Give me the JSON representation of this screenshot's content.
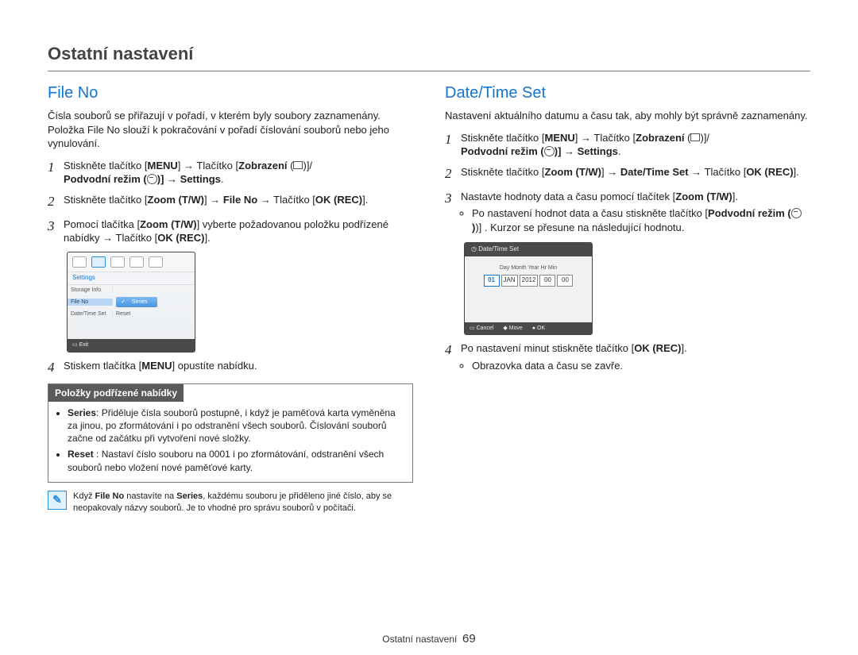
{
  "chapter": "Ostatní nastavení",
  "left": {
    "heading": "File No",
    "intro": "Čísla souborů se přiřazují v pořadí, v kterém byly soubory zaznamenány. Položka File No slouží k pokračování v pořadí číslování souborů nebo jeho vynulování.",
    "steps": {
      "s1a": "Stiskněte tlačítko [",
      "s1b": "] → Tlačítko [",
      "s1c": " (",
      "s1d": ")]/",
      "s1e": "Podvodní režim (",
      "s1f": ")] → ",
      "s1g": ".",
      "menu": "MENU",
      "display": "Zobrazení",
      "settings": "Settings",
      "s2a": "Stiskněte tlačítko [",
      "s2b": "] → ",
      "s2c": " → Tlačítko [",
      "s2d": "].",
      "zoom": "Zoom (T/W)",
      "fileno": "File No",
      "okrec": "OK (REC)",
      "s3a": "Pomocí tlačítka [",
      "s3b": "] vyberte požadovanou položku podřízené nabídky → Tlačítko [",
      "s3c": "].",
      "s4a": "Stiskem tlačítka [",
      "s4b": "] opustíte nabídku."
    },
    "shot": {
      "settings": "Settings",
      "storage": "Storage Info",
      "fileno": "File No",
      "datetime": "Date/Time Set",
      "series": "Series",
      "reset": "Reset",
      "exit": "Exit"
    },
    "subbox": {
      "title": "Položky podřízené nabídky",
      "series_label": "Series",
      "series_text": ": Přiděluje čísla souborů postupně, i když je paměťová karta vyměněna za jinou, po zformátování i po odstranění všech souborů. Číslování souborů začne od začátku při vytvoření nové složky.",
      "reset_label": "Reset",
      "reset_text": " : Nastaví číslo souboru na 0001 i po zformátování, odstranění všech souborů nebo vložení nové paměťové karty."
    },
    "tip_a": "Když ",
    "tip_bold1": "File No",
    "tip_b": " nastavíte na ",
    "tip_bold2": "Series",
    "tip_c": ", každému souboru je přiděleno jiné číslo, aby se neopakovaly názvy souborů. Je to vhodné pro správu souborů v počítači."
  },
  "right": {
    "heading": "Date/Time Set",
    "intro": "Nastavení aktuálního datumu a času tak, aby mohly být správně zaznamenány.",
    "steps": {
      "s1a": "Stiskněte tlačítko [",
      "s1b": "] → Tlačítko [",
      "s1c": " (",
      "s1d": ")]/",
      "s1e": "Podvodní režim (",
      "s1f": ")] → ",
      "s1g": ".",
      "menu": "MENU",
      "display": "Zobrazení",
      "settings": "Settings",
      "s2a": "Stiskněte tlačítko [",
      "s2b": "] → ",
      "s2c": " → Tlačítko [",
      "s2d": "].",
      "zoom": "Zoom (T/W)",
      "dts": "Date/Time Set",
      "okrec": "OK (REC)",
      "s3a": "Nastavte hodnoty data a času pomocí tlačítek [",
      "s3b": "].",
      "s3sub_a": "Po nastavení hodnot data a času stiskněte tlačítko [",
      "s3sub_bold": "Podvodní režim (",
      "s3sub_b": ")] . Kurzor se přesune na následující hodnotu.",
      "s4a": "Po nastavení minut stiskněte tlačítko [",
      "s4b": "].",
      "s4sub": "Obrazovka data a času se zavře."
    },
    "shot": {
      "title": "Date/Time Set",
      "labels": "Day   Month   Year     Hr     Min",
      "day": "01",
      "month": "JAN",
      "year": "2012",
      "hr": "00",
      "min": "00",
      "cancel": "Cancel",
      "move": "Move",
      "ok": "OK"
    }
  },
  "footer": {
    "label": "Ostatní nastavení",
    "page": "69"
  }
}
